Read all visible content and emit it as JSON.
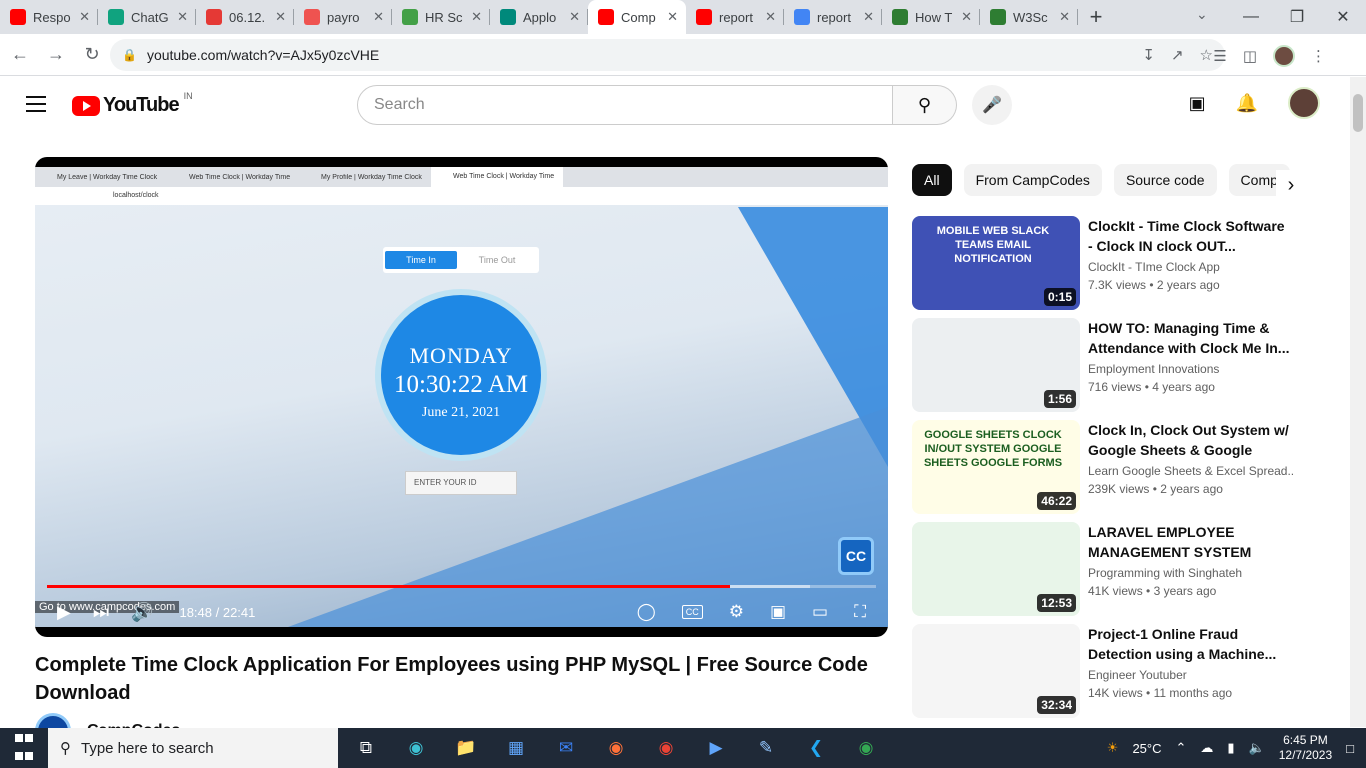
{
  "browser": {
    "tabs": [
      {
        "label": "Respo",
        "color": "#ff0000"
      },
      {
        "label": "ChatG",
        "color": "#10a37f"
      },
      {
        "label": "06.12.",
        "color": "#e53935"
      },
      {
        "label": "payro",
        "color": "#ef5350"
      },
      {
        "label": "HR Sc",
        "color": "#43a047"
      },
      {
        "label": "Applo",
        "color": "#00897b"
      },
      {
        "label": "Comp",
        "color": "#ff0000"
      },
      {
        "label": "report",
        "color": "#ff0000"
      },
      {
        "label": "report",
        "color": "#4285f4"
      },
      {
        "label": "How T",
        "color": "#2e7d32"
      },
      {
        "label": "W3Sc",
        "color": "#2e7d32"
      }
    ],
    "url": "youtube.com/watch?v=AJx5y0zcVHE"
  },
  "yt": {
    "logo": "YouTube",
    "country": "IN",
    "search_placeholder": "Search"
  },
  "video": {
    "tabs": [
      "My Leave | Workday Time Clock",
      "Web Time Clock | Workday Time",
      "My Profile | Workday Time Clock",
      "Web Time Clock | Workday Time"
    ],
    "url": "localhost/clock",
    "toggle_in": "Time In",
    "toggle_out": "Time Out",
    "day": "MONDAY",
    "time": "10:30:22 AM",
    "date": "June 21, 2021",
    "input_placeholder": "ENTER YOUR ID",
    "badge": "CC",
    "goto": "Go to www.campcodes.com",
    "progress": 0.824,
    "time_display": "18:48 / 22:41",
    "cc_label": "CC",
    "title": "Complete Time Clock Application For Employees using PHP MySQL | Free Source Code Download",
    "channel": "CampCodes"
  },
  "chips": [
    "All",
    "From CampCodes",
    "Source code",
    "Comp"
  ],
  "recommendations": [
    {
      "title": "ClockIt - Time Clock Software - Clock IN clock OUT...",
      "channel": "ClockIt - TIme Clock App",
      "views": "7.3K views",
      "age": "2 years ago",
      "duration": "0:15",
      "thumb": "#3f51b5",
      "thumb_text": "MOBILE WEB SLACK TEAMS EMAIL NOTIFICATION"
    },
    {
      "title": "HOW TO: Managing Time & Attendance with Clock Me In...",
      "channel": "Employment Innovations",
      "views": "716 views",
      "age": "4 years ago",
      "duration": "1:56",
      "thumb": "#eceff1",
      "thumb_text": ""
    },
    {
      "title": "Clock In, Clock Out System w/ Google Sheets & Google Form...",
      "channel": "Learn Google Sheets & Excel Spread...",
      "views": "239K views",
      "age": "2 years ago",
      "duration": "46:22",
      "thumb": "#fffde7",
      "thumb_text": "GOOGLE SHEETS CLOCK IN/OUT SYSTEM GOOGLE SHEETS GOOGLE FORMS"
    },
    {
      "title": "LARAVEL EMPLOYEE MANAGEMENT SYSTEM WITH...",
      "channel": "Programming with Singhateh",
      "views": "41K views",
      "age": "3 years ago",
      "duration": "12:53",
      "thumb": "#e8f5e9",
      "thumb_text": ""
    },
    {
      "title": "Project-1 Online Fraud Detection using a Machine...",
      "channel": "Engineer Youtuber",
      "views": "14K views",
      "age": "11 months ago",
      "duration": "32:34",
      "thumb": "#f5f5f5",
      "thumb_text": ""
    }
  ],
  "taskbar": {
    "search": "Type here to search",
    "temp": "25°C",
    "time": "6:45 PM",
    "date": "12/7/2023"
  }
}
